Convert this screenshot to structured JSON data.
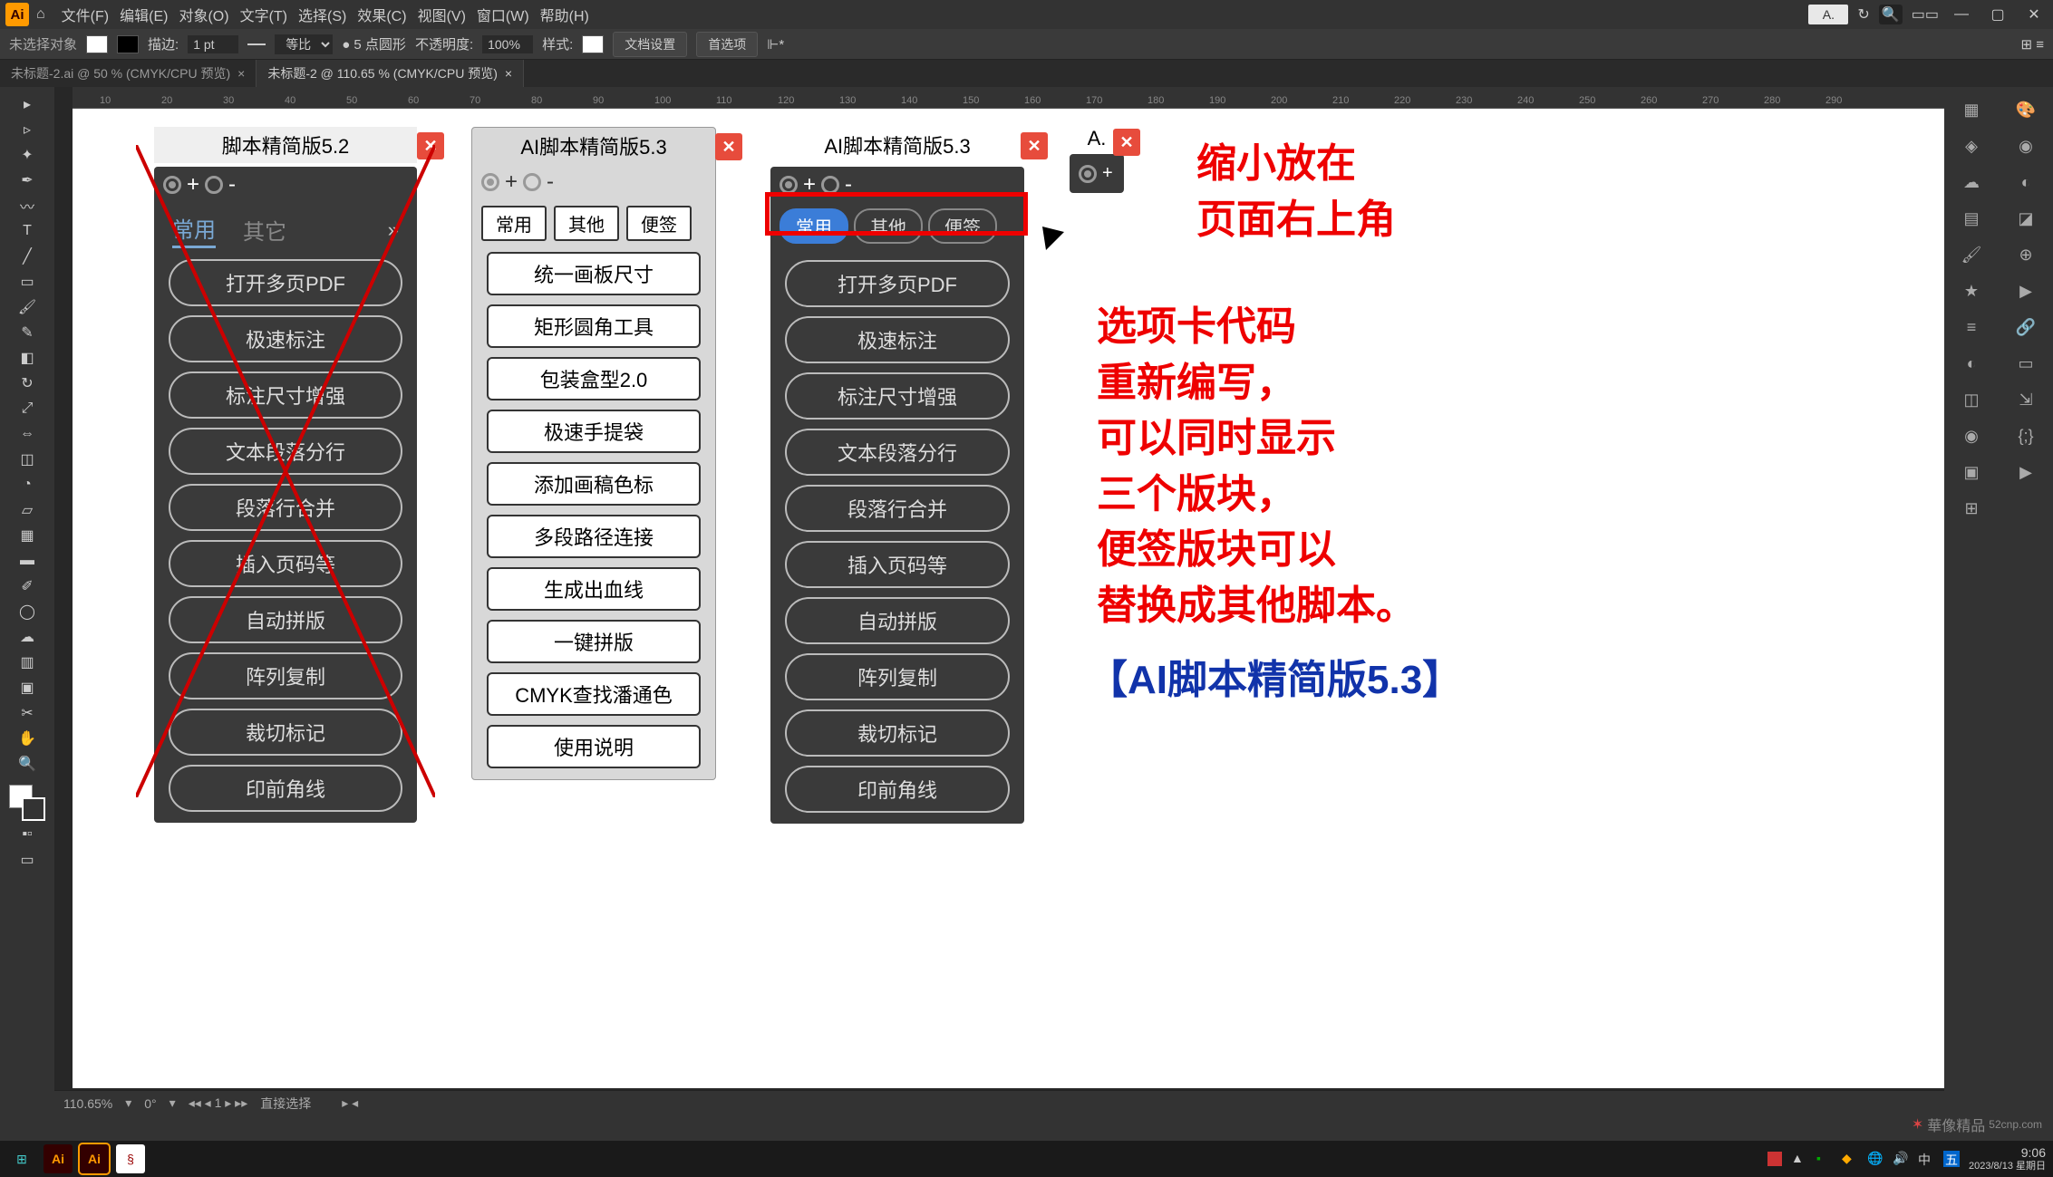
{
  "menus": [
    "文件(F)",
    "编辑(E)",
    "对象(O)",
    "文字(T)",
    "选择(S)",
    "效果(C)",
    "视图(V)",
    "窗口(W)",
    "帮助(H)"
  ],
  "top_small_panel": "A.",
  "control_bar": {
    "no_sel": "未选择对象",
    "stroke_label": "描边:",
    "stroke_pt": "1 pt",
    "uniform": "等比",
    "corner_label": "5 点圆形",
    "opacity_label": "不透明度:",
    "opacity_val": "100%",
    "style_label": "样式:",
    "doc_setup": "文档设置",
    "prefs": "首选项"
  },
  "tabs": [
    {
      "label": "未标题-2.ai @ 50 % (CMYK/CPU 预览)",
      "active": false
    },
    {
      "label": "未标题-2 @ 110.65 % (CMYK/CPU 预览)",
      "active": true
    }
  ],
  "ruler_marks": [
    "10",
    "20",
    "30",
    "40",
    "50",
    "60",
    "70",
    "80",
    "90",
    "100",
    "110",
    "120",
    "130",
    "140",
    "150",
    "160",
    "170",
    "180",
    "190",
    "200",
    "210",
    "220",
    "230",
    "240",
    "250",
    "260",
    "270",
    "280",
    "290"
  ],
  "panel52": {
    "title": "脚本精简版5.2",
    "tabs": [
      "常用",
      "其它"
    ],
    "buttons": [
      "打开多页PDF",
      "极速标注",
      "标注尺寸增强",
      "文本段落分行",
      "段落行合并",
      "插入页码等",
      "自动拼版",
      "阵列复制",
      "裁切标记",
      "印前角线"
    ]
  },
  "panel53_light": {
    "title": "AI脚本精简版5.3",
    "tabs": [
      "常用",
      "其他",
      "便签"
    ],
    "buttons": [
      "统一画板尺寸",
      "矩形圆角工具",
      "包装盒型2.0",
      "极速手提袋",
      "添加画稿色标",
      "多段路径连接",
      "生成出血线",
      "一键拼版",
      "CMYK查找潘通色",
      "使用说明"
    ]
  },
  "panel53_dark": {
    "title": "AI脚本精简版5.3",
    "tabs": [
      "常用",
      "其他",
      "便签"
    ],
    "buttons": [
      "打开多页PDF",
      "极速标注",
      "标注尺寸增强",
      "文本段落分行",
      "段落行合并",
      "插入页码等",
      "自动拼版",
      "阵列复制",
      "裁切标记",
      "印前角线"
    ]
  },
  "panel_mini": {
    "title": "A."
  },
  "annotations": {
    "top": "缩小放在\n页面右上角",
    "mid": "选项卡代码\n重新编写，\n可以同时显示\n三个版块，\n便签版块可以\n替换成其他脚本。",
    "bottom": "【AI脚本精简版5.3】"
  },
  "status": {
    "zoom": "110.65%",
    "angle": "0°",
    "artboard": "1",
    "tool": "直接选择"
  },
  "taskbar": {
    "time": "9:06",
    "date": "2023/8/13 星期日"
  },
  "watermark": "52cnp.com"
}
